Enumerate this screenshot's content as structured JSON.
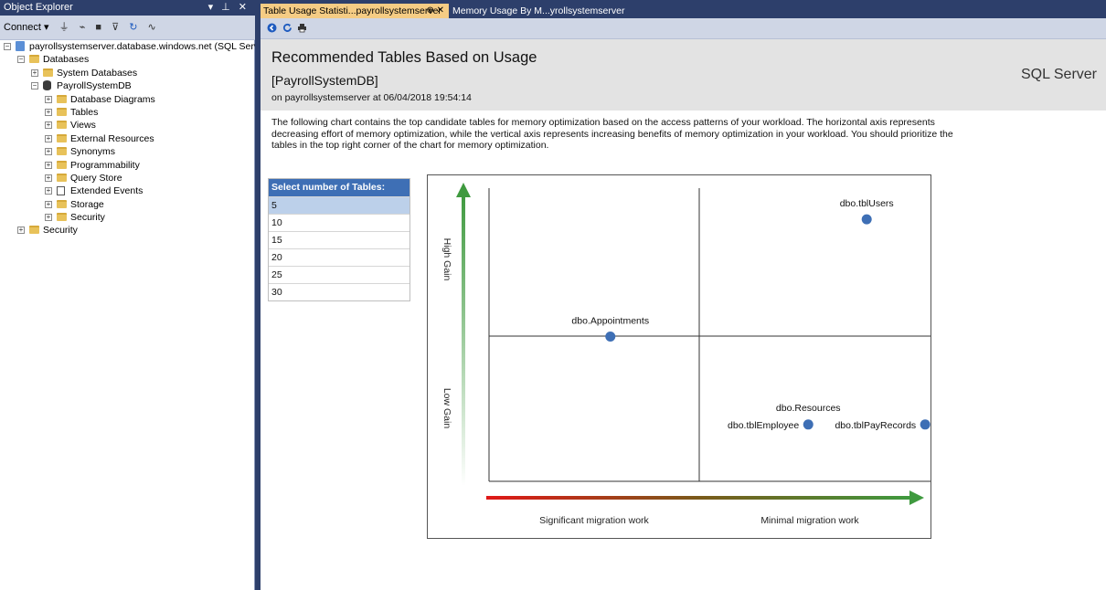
{
  "object_explorer": {
    "title": "Object Explorer",
    "title_actions": "▾ ⊥ ✕",
    "connect_label": "Connect ▾",
    "tree": [
      {
        "label": "payrollsystemserver.database.windows.net (SQL Server",
        "level": 0,
        "icon": "server-icon",
        "expander": "minus"
      },
      {
        "label": "Databases",
        "level": 1,
        "icon": "folder-icon",
        "expander": "minus"
      },
      {
        "label": "System Databases",
        "level": 2,
        "icon": "folder-icon",
        "expander": "plus"
      },
      {
        "label": "PayrollSystemDB",
        "level": 2,
        "icon": "database-icon",
        "expander": "minus"
      },
      {
        "label": "Database Diagrams",
        "level": 3,
        "icon": "folder-icon",
        "expander": "plus"
      },
      {
        "label": "Tables",
        "level": 3,
        "icon": "folder-icon",
        "expander": "plus"
      },
      {
        "label": "Views",
        "level": 3,
        "icon": "folder-icon",
        "expander": "plus"
      },
      {
        "label": "External Resources",
        "level": 3,
        "icon": "folder-icon",
        "expander": "plus"
      },
      {
        "label": "Synonyms",
        "level": 3,
        "icon": "folder-icon",
        "expander": "plus"
      },
      {
        "label": "Programmability",
        "level": 3,
        "icon": "folder-icon",
        "expander": "plus"
      },
      {
        "label": "Query Store",
        "level": 3,
        "icon": "folder-icon",
        "expander": "plus"
      },
      {
        "label": "Extended Events",
        "level": 3,
        "icon": "extended-events-icon",
        "expander": "plus"
      },
      {
        "label": "Storage",
        "level": 3,
        "icon": "folder-icon",
        "expander": "plus"
      },
      {
        "label": "Security",
        "level": 3,
        "icon": "folder-icon",
        "expander": "plus"
      },
      {
        "label": "Security",
        "level": 1,
        "icon": "folder-icon",
        "expander": "plus"
      }
    ]
  },
  "tabs": [
    {
      "label": "Table Usage Statisti...payrollsystemserver",
      "active": true,
      "icons": "⊕ ✕"
    },
    {
      "label": "Memory Usage By M...yrollsystemserver",
      "active": false
    }
  ],
  "report": {
    "title": "Recommended Tables Based on Usage",
    "database": "[PayrollSystemDB]",
    "server_line": "on payrollsystemserver at 06/04/2018 19:54:14",
    "product": "SQL Server",
    "description": "The following chart contains the top candidate tables for memory optimization based on the access patterns of your workload. The horizontal axis represents decreasing effort of memory optimization, while the vertical axis represents increasing benefits of memory optimization in your workload. You should prioritize the tables in the top right corner of the chart for memory optimization."
  },
  "table_selector": {
    "header": "Select number of Tables:",
    "options": [
      "5",
      "10",
      "15",
      "20",
      "25",
      "30"
    ],
    "selected": "5"
  },
  "chart_data": {
    "type": "scatter",
    "x_axis_labels": [
      "Significant migration work",
      "Minimal migration work"
    ],
    "y_axis_labels": [
      "High Gain",
      "Low Gain"
    ],
    "point_color": "#3e6fb5",
    "points": [
      {
        "label": "dbo.tblUsers",
        "x": 0.85,
        "y": 0.9
      },
      {
        "label": "dbo.Appointments",
        "x": 0.28,
        "y": 0.5
      },
      {
        "label": "dbo.Resources",
        "x": 0.72,
        "y": 0.2
      },
      {
        "label": "dbo.tblEmployee",
        "x": 0.72,
        "y": 0.2
      },
      {
        "label": "dbo.tblPayRecords",
        "x": 0.98,
        "y": 0.2
      }
    ]
  }
}
